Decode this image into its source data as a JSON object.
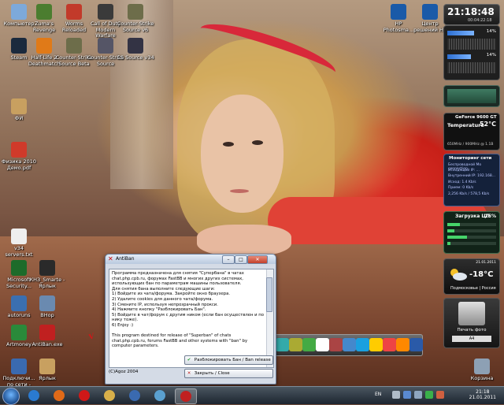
{
  "desktop_icons": [
    {
      "label": "Компьютер",
      "color": "#7da9da"
    },
    {
      "label": "Zuma's Revenge",
      "color": "#4b7d2f"
    },
    {
      "label": "Worms Reloaded",
      "color": "#c23a2a"
    },
    {
      "label": "Call of Duty Modern Warfare",
      "color": "#3a3a3a"
    },
    {
      "label": "Counter-Strike Source v6",
      "color": "#6d6d4a"
    },
    {
      "label": "Steam",
      "color": "#1b2a3d"
    },
    {
      "label": "Half-Life 2 Deathmatch",
      "color": "#e07a18"
    },
    {
      "label": "Counter-Strike Source Beta",
      "color": "#6d6d4a"
    },
    {
      "label": "Counter-Strike Source",
      "color": "#556"
    },
    {
      "label": "CS Source v34",
      "color": "#334"
    },
    {
      "label": "ФИ",
      "color": "#c8a060"
    },
    {
      "label": "Физика 2010 Демо.pdf",
      "color": "#d03a2a"
    },
    {
      "label": "v34 servers.txt",
      "color": "#eeeeee"
    },
    {
      "label": "Microsoft Security...",
      "color": "#1d6b2a"
    },
    {
      "label": "КНЗ_Smarte - Ярлык",
      "color": "#2a2a2a"
    },
    {
      "label": "autoruns",
      "color": "#3b6fb0"
    },
    {
      "label": "BHop",
      "color": "#6a8ab0"
    },
    {
      "label": "Artmoney",
      "color": "#2a8a3a"
    },
    {
      "label": "AntiBan.exe",
      "color": "#c02020"
    },
    {
      "label": "Подключи... по сети - Ярлык",
      "color": "#3a6ab0"
    },
    {
      "label": "Ярлык",
      "color": "#c8a060"
    },
    {
      "label": "HP Photosma...",
      "color": "#1a5aa8"
    },
    {
      "label": "Центр решений HP",
      "color": "#1a5aa8"
    },
    {
      "label": "Корзина",
      "color": "#8da0b4"
    }
  ],
  "gadgets": {
    "clock": {
      "time": "21:18:48",
      "date": "00:04:22:18"
    },
    "meters": [
      {
        "label": "CPU",
        "value": "14%"
      },
      {
        "label": "RAM",
        "value": "14%"
      }
    ],
    "gpu": {
      "title": "GeForce 9600 GT",
      "temp_label": "Temperature",
      "temp_value": "52°C",
      "freq": "650MHz / 900MHz @ 1.1В"
    },
    "network": {
      "title": "Мониторинг сети",
      "lines": [
        "Беспроводной Mo connection",
        "Исходящий IP: ...",
        "Внутренний IP: 192.168...",
        "Исход: 1.4 Kb/s",
        "Прием: 0 Kb/s",
        "2,256 Kb/s / 578,5 Kb/s"
      ]
    },
    "cpu": {
      "title": "Загрузка ЦП",
      "percent": "26%",
      "cores": [
        0.26,
        0.14,
        0.4,
        0.06
      ]
    },
    "weather": {
      "date": "21.01.2011",
      "temp": "-18°C",
      "city": "Подмосковье | Россия"
    },
    "printer": {
      "label": "Печать фото",
      "size": "A4",
      "brand": "hp"
    }
  },
  "window": {
    "title": "AntiBan",
    "min": "–",
    "max": "□",
    "close": "✕",
    "text": "Программа предназначена для снятия \"Супербана\" в чатах chat.php.cpb.ru, форумах FastBB и многих других системах, использующих бан по параметрам машины пользователя.\nДля снятия бана выполните следующие шаги:\n1) Войдите из чата/форума. Закройте окно браузера.\n2) Удалите cookies для данного чата/форума.\n3) Смените IP, используя непрозрачный прокси.\n4) Нажмите кнопку \"Разблокировать Бан\".\n5) Войдите в чат/форум с другим ником (если бан осуществлен и по нику тоже).\n6) Enjoy :)\n\nThis program destined for release of \"Superban\" of chats chat.php.cpb.ru, forums FastBB and other systems with \"ban\" by computer parameters.",
    "copyright": "(C)Agoz 2004",
    "unban_label": "Разблокировать Бан / Ban release",
    "close_label": "Закрыть / Close",
    "scroll_position": 0.08
  },
  "taskbar": {
    "items": [
      "ie",
      "firefox",
      "opera",
      "explorer",
      "media",
      "mail",
      "antiban"
    ],
    "active_index": 6,
    "lang": "EN",
    "time": "21:18",
    "date": "21.01.2011"
  },
  "dock_items": [
    "app1",
    "app2",
    "app3",
    "app4",
    "app5",
    "max",
    "skype",
    "app8",
    "app9",
    "app10",
    "photoshop"
  ],
  "colors": {
    "accent": "#c02020",
    "window_bg": "#d4dbe6",
    "taskbar": "#1d2530"
  }
}
